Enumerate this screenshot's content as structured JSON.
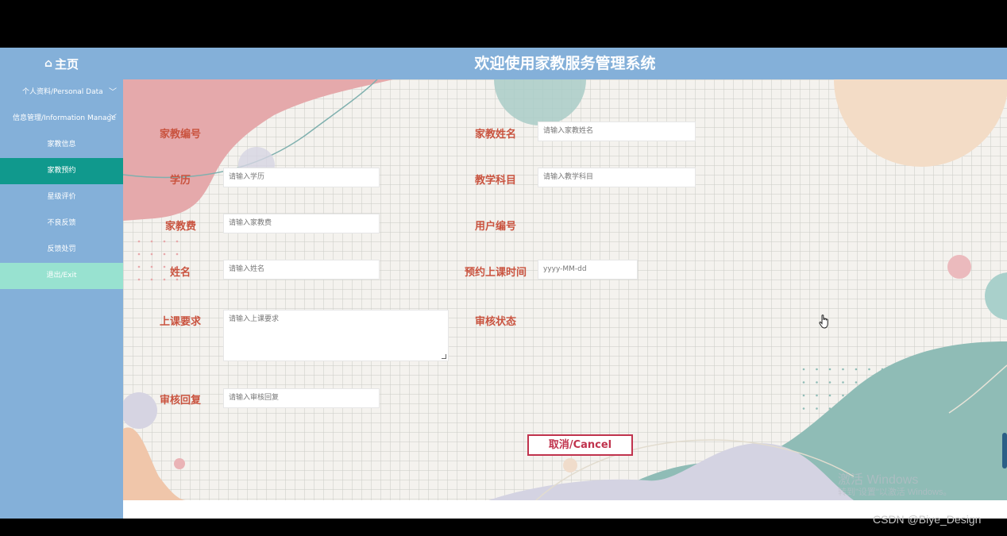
{
  "header": {
    "home_icon": "home-icon",
    "home_label": "主页",
    "title": "欢迎使用家教服务管理系统"
  },
  "sidebar": {
    "items": [
      {
        "label": "个人资料/Personal Data",
        "type": "group",
        "chevron": "﹀"
      },
      {
        "label": "信息管理/Information Manage",
        "type": "group",
        "chevron": "﹀"
      },
      {
        "label": "家教信息",
        "type": "item"
      },
      {
        "label": "家教预约",
        "type": "item",
        "active": true
      },
      {
        "label": "星级评价",
        "type": "item"
      },
      {
        "label": "不良反馈",
        "type": "item"
      },
      {
        "label": "反馈处罚",
        "type": "item"
      },
      {
        "label": "退出/Exit",
        "type": "exit"
      }
    ]
  },
  "form": {
    "tutor_id": {
      "label": "家教编号"
    },
    "tutor_name": {
      "label": "家教姓名",
      "placeholder": "请输入家教姓名"
    },
    "education": {
      "label": "学历",
      "placeholder": "请输入学历"
    },
    "subject": {
      "label": "教学科目",
      "placeholder": "请输入教学科目"
    },
    "fee": {
      "label": "家教费",
      "placeholder": "请输入家教费"
    },
    "user_id": {
      "label": "用户编号"
    },
    "name": {
      "label": "姓名",
      "placeholder": "请输入姓名"
    },
    "booking_time": {
      "label": "预约上课时间",
      "placeholder": "yyyy-MM-dd"
    },
    "requirements": {
      "label": "上课要求",
      "placeholder": "请输入上课要求"
    },
    "review_status": {
      "label": "审核状态"
    },
    "review_reply": {
      "label": "审核回复",
      "placeholder": "请输入审核回复"
    },
    "cancel_label": "取消/Cancel"
  },
  "overlay": {
    "watermark_title": "激活 Windows",
    "watermark_sub": "转到\"设置\"以激活 Windows。",
    "credit": "CSDN @Biye_Design"
  },
  "colors": {
    "sidebar_bg": "#84b0d9",
    "active_item": "#10998d",
    "exit_item": "#98e2d0",
    "label_text": "#c9533f",
    "cancel_border": "#c0334d"
  }
}
